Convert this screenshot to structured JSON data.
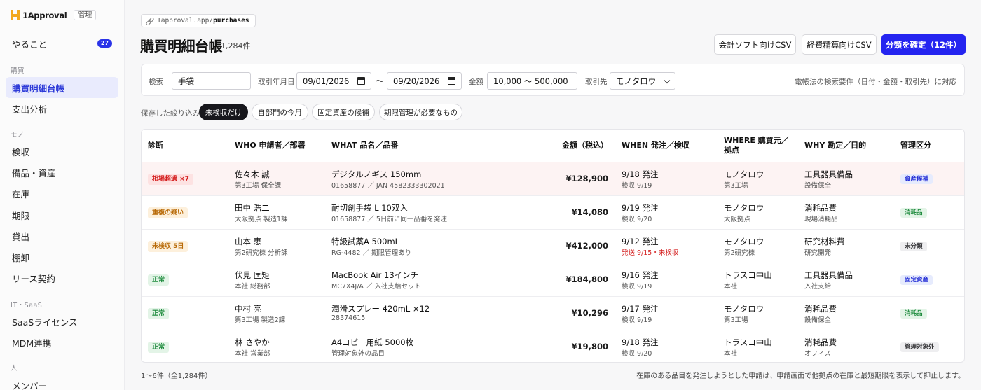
{
  "app": {
    "name": "1Approval",
    "tag": "管理",
    "accent": "#2424f0"
  },
  "sidebar": {
    "todo": {
      "label": "やること",
      "badge": "27"
    },
    "sections": [
      {
        "title": "購買",
        "items": [
          {
            "label": "購買明細台帳",
            "active": true
          },
          {
            "label": "支出分析"
          }
        ]
      },
      {
        "title": "モノ",
        "items": [
          {
            "label": "検収"
          },
          {
            "label": "備品・資産"
          },
          {
            "label": "在庫"
          },
          {
            "label": "期限"
          },
          {
            "label": "貸出"
          },
          {
            "label": "棚卸"
          },
          {
            "label": "リース契約"
          }
        ]
      },
      {
        "title": "IT・SaaS",
        "items": [
          {
            "label": "SaaSライセンス"
          },
          {
            "label": "MDM連携"
          }
        ]
      },
      {
        "title": "人",
        "items": [
          {
            "label": "メンバー"
          }
        ]
      }
    ]
  },
  "header": {
    "url_prefix": "1approval.app/",
    "url_path": "purchases",
    "title": "購買明細台帳",
    "count": "1,284件",
    "buttons": {
      "accounting_csv": "会計ソフト向けCSV",
      "expense_csv": "経費精算向けCSV",
      "confirm": "分類を確定（12件）"
    }
  },
  "filters": {
    "search_label": "検索",
    "search_value": "手袋",
    "date_label": "取引年月日",
    "date_from": "09/01/2026",
    "date_sep": "〜",
    "date_to": "09/20/2026",
    "amount_label": "金額",
    "amount_value": "10,000 〜 500,000",
    "vendor_label": "取引先",
    "vendor_value": "モノタロウ",
    "note": "電帳法の検索要件（日付・金額・取引先）に対応"
  },
  "saved": {
    "label": "保存した絞り込み",
    "chips": [
      {
        "label": "未検収だけ",
        "active": true
      },
      {
        "label": "自部門の今月"
      },
      {
        "label": "固定資産の候補"
      },
      {
        "label": "期限管理が必要なもの"
      }
    ]
  },
  "table": {
    "headers": {
      "diag": "診断",
      "who": "WHO 申請者／部署",
      "what": "WHAT 品名／品番",
      "amount": "金額（税込）",
      "when": "WHEN 発注／検収",
      "where": "WHERE 購買元／拠点",
      "why": "WHY 勘定／目的",
      "cls": "管理区分"
    },
    "rows": [
      {
        "diag": "相場超過 ×7",
        "diag_tone": "red",
        "who": "佐々木 誠",
        "dept": "第3工場 保全課",
        "what": "デジタルノギス 150mm",
        "code": "01658877 ／ JAN 4582333302021",
        "amount": "¥128,900",
        "when": "9/18 発注",
        "when2": "検収 9/19",
        "when2_red": false,
        "where": "モノタロウ",
        "site": "第3工場",
        "why": "工具器具備品",
        "purpose": "設備保全",
        "cls": "資産候補",
        "cls_tone": "blue"
      },
      {
        "diag": "重複の疑い",
        "diag_tone": "orange",
        "who": "田中 浩二",
        "dept": "大阪拠点 製造1課",
        "what": "耐切創手袋 L 10双入",
        "code": "01658877 ／ 5日前に同一品番を発注",
        "amount": "¥14,080",
        "when": "9/19 発注",
        "when2": "検収 9/20",
        "when2_red": false,
        "where": "モノタロウ",
        "site": "大阪拠点",
        "why": "消耗品費",
        "purpose": "現場消耗品",
        "cls": "消耗品",
        "cls_tone": "green"
      },
      {
        "diag": "未検収 5日",
        "diag_tone": "orange",
        "who": "山本 恵",
        "dept": "第2研究棟 分析課",
        "what": "特級試薬A 500mL",
        "code": "RG-4482 ／ 期限管理あり",
        "amount": "¥412,000",
        "when": "9/12 発注",
        "when2": "発送 9/15・未検収",
        "when2_red": true,
        "where": "モノタロウ",
        "site": "第2研究棟",
        "why": "研究材料費",
        "purpose": "研究開発",
        "cls": "未分類",
        "cls_tone": "gray"
      },
      {
        "diag": "正常",
        "diag_tone": "green",
        "who": "伏見 匡矩",
        "dept": "本社 総務部",
        "what": "MacBook Air 13インチ",
        "code": "MC7X4J/A ／ 入社支給セット",
        "amount": "¥184,800",
        "when": "9/16 発注",
        "when2": "検収 9/19",
        "when2_red": false,
        "where": "トラスコ中山",
        "site": "本社",
        "why": "工具器具備品",
        "purpose": "入社支給",
        "cls": "固定資産",
        "cls_tone": "blue"
      },
      {
        "diag": "正常",
        "diag_tone": "green",
        "who": "中村 亮",
        "dept": "第3工場 製造2課",
        "what": "潤滑スプレー 420mL ×12",
        "code": "28374615",
        "amount": "¥10,296",
        "when": "9/17 発注",
        "when2": "検収 9/19",
        "when2_red": false,
        "where": "モノタロウ",
        "site": "第3工場",
        "why": "消耗品費",
        "purpose": "設備保全",
        "cls": "消耗品",
        "cls_tone": "green"
      },
      {
        "diag": "正常",
        "diag_tone": "green",
        "who": "林 さやか",
        "dept": "本社 営業部",
        "what": "A4コピー用紙 5000枚",
        "code": "管理対象外の品目",
        "amount": "¥19,800",
        "when": "9/18 発注",
        "when2": "検収 9/20",
        "when2_red": false,
        "where": "トラスコ中山",
        "site": "本社",
        "why": "消耗品費",
        "purpose": "オフィス",
        "cls": "管理対象外",
        "cls_tone": "gray"
      }
    ]
  },
  "footer": {
    "range": "1〜6件（全1,284件）",
    "note": "在庫のある品目を発注しようとした申請は、申請画面で他拠点の在庫と最短期限を表示して抑止します。"
  },
  "tones": {
    "red": {
      "bg": "#fde2e2",
      "fg": "#d41c1c"
    },
    "orange": {
      "bg": "#fdf0dc",
      "fg": "#b86a08"
    },
    "green": {
      "bg": "#e3f4e7",
      "fg": "#1c8a3c"
    },
    "blue": {
      "bg": "#e6ebfd",
      "fg": "#2630d6"
    },
    "gray": {
      "bg": "#eeeef0",
      "fg": "#333336"
    }
  }
}
